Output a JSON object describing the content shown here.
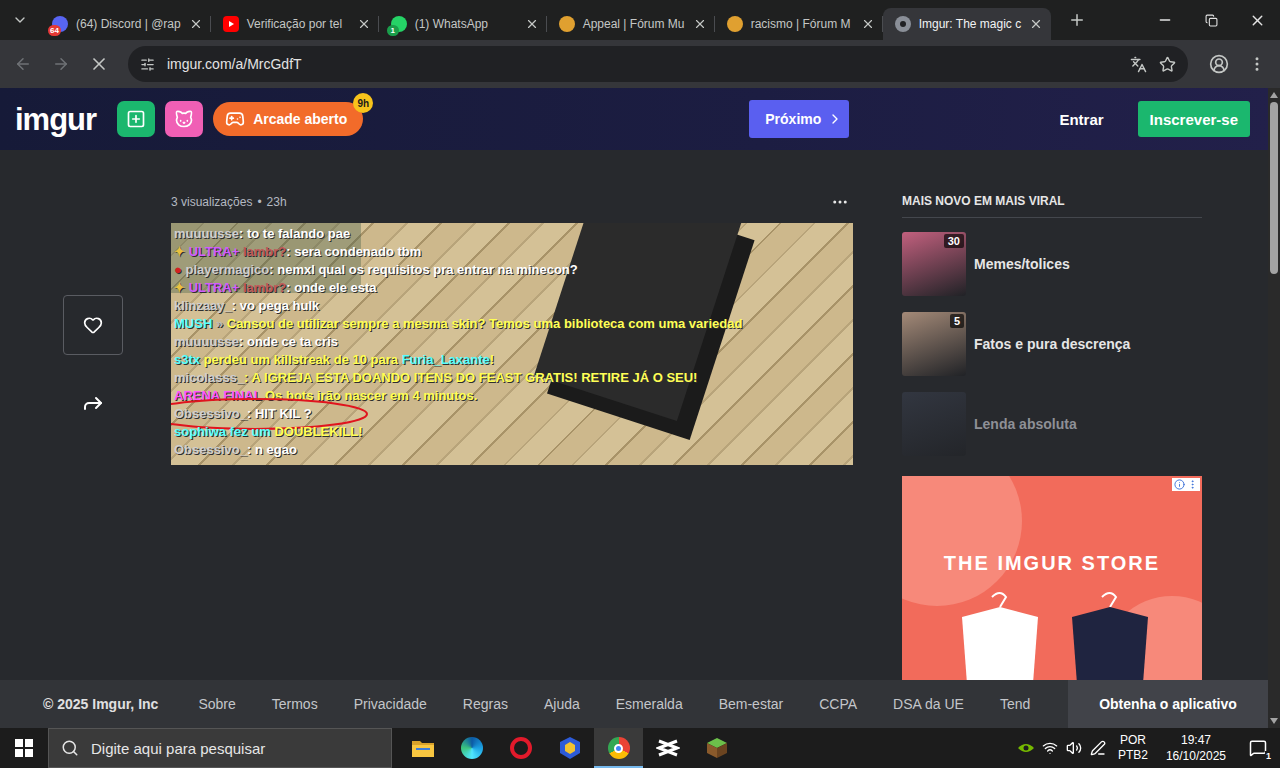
{
  "browser": {
    "tabs": [
      {
        "label": "(64) Discord | @rap",
        "kind": "discord",
        "badge": "64",
        "selected": false
      },
      {
        "label": "Verificação por tel",
        "kind": "youtube",
        "selected": false
      },
      {
        "label": "(1) WhatsApp",
        "kind": "whatsapp",
        "badge": "1",
        "selected": false
      },
      {
        "label": "Appeal | Fórum Mu",
        "kind": "forum",
        "selected": false
      },
      {
        "label": "racismo | Fórum M",
        "kind": "forum",
        "selected": false
      },
      {
        "label": "Imgur: The magic c",
        "kind": "imgur",
        "selected": true
      }
    ],
    "address": "imgur.com/a/MrcGdfT",
    "loading": true
  },
  "imgur_header": {
    "logo": "imgur",
    "arcade": "Arcade aberto",
    "arcade_badge": "9h",
    "next": "Próximo",
    "login": "Entrar",
    "signup": "Inscrever-se"
  },
  "post": {
    "views": "3 visualizações",
    "separator": "•",
    "age": "23h",
    "liked": false,
    "chat": [
      {
        "circled": false,
        "segments": [
          {
            "text": "muuuusse",
            "color": "#cfcfcf"
          },
          {
            "text": ": to te falando pae",
            "color": "#ffffff"
          }
        ]
      },
      {
        "circled": false,
        "segments": [
          {
            "text": "✦ ",
            "color": "#e8c040"
          },
          {
            "text": "ULTRA+",
            "color": "#d05cff"
          },
          {
            "text": " lambr?",
            "color": "#c05a5a"
          },
          {
            "text": ": sera condenado tbm",
            "color": "#ffffff"
          }
        ]
      },
      {
        "circled": false,
        "segments": [
          {
            "text": "● ",
            "color": "#d42020"
          },
          {
            "text": "playermagico",
            "color": "#cfcfcf"
          },
          {
            "text": ": nemxl qual os requisitos pra entrar na minecon?",
            "color": "#ffffff"
          }
        ]
      },
      {
        "circled": false,
        "segments": [
          {
            "text": "✦ ",
            "color": "#e8c040"
          },
          {
            "text": "ULTRA+",
            "color": "#d05cff"
          },
          {
            "text": " lambr?",
            "color": "#c05a5a"
          },
          {
            "text": ": onde ele esta",
            "color": "#ffffff"
          }
        ]
      },
      {
        "circled": false,
        "segments": [
          {
            "text": "klinzaay_",
            "color": "#cfcfcf"
          },
          {
            "text": ": vo pega hulk",
            "color": "#ffffff"
          }
        ]
      },
      {
        "circled": false,
        "segments": [
          {
            "text": "MUSH",
            "color": "#55ffff"
          },
          {
            "text": " » ",
            "color": "#bbbbbb"
          },
          {
            "text": "Cansou de utilizar sempre a mesma skin? Temos uma biblioteca com uma variedad",
            "color": "#ffff55"
          }
        ]
      },
      {
        "circled": false,
        "segments": [
          {
            "text": "muuuusse",
            "color": "#cfcfcf"
          },
          {
            "text": ": onde ce ta cris",
            "color": "#ffffff"
          }
        ]
      },
      {
        "circled": false,
        "segments": [
          {
            "text": "s3tx",
            "color": "#55ffff"
          },
          {
            "text": " perdeu um killstreak de 10 para ",
            "color": "#ffff55"
          },
          {
            "text": "Furia_Laxante",
            "color": "#55ffff"
          },
          {
            "text": "!",
            "color": "#ffff55"
          }
        ]
      },
      {
        "circled": false,
        "segments": [
          {
            "text": "micolasss_",
            "color": "#cfcfcf"
          },
          {
            "text": ": A IGREJA ESTA DOANDO ITENS DO FEAST GRATIS! RETIRE JÁ O SEU!",
            "color": "#ffff55"
          }
        ]
      },
      {
        "circled": false,
        "segments": [
          {
            "text": "ARENA FINAL",
            "color": "#ff55ff"
          },
          {
            "text": " Os bots irão nascer em 4 minutos.",
            "color": "#ffff55"
          }
        ]
      },
      {
        "circled": true,
        "segments": [
          {
            "text": "Obsessivo_",
            "color": "#cfcfcf"
          },
          {
            "text": ": HIT KIL ?",
            "color": "#ffffff"
          }
        ]
      },
      {
        "circled": false,
        "segments": [
          {
            "text": "sophiwa fez um ",
            "color": "#55ffff"
          },
          {
            "text": "DOUBLEKILL!",
            "color": "#ffff55"
          }
        ]
      },
      {
        "circled": false,
        "segments": [
          {
            "text": "Obsessivo_",
            "color": "#cfcfcf"
          },
          {
            "text": ": n egao",
            "color": "#ffffff"
          }
        ]
      }
    ]
  },
  "sidebar": {
    "title": "MAIS NOVO EM MAIS VIRAL",
    "items": [
      {
        "label": "Memes/tolices",
        "count": "30",
        "faded": false,
        "color": "#c2607e"
      },
      {
        "label": "Fatos e pura descrença",
        "count": "5",
        "faded": false,
        "color": "#a48a78"
      },
      {
        "label": "Lenda absoluta",
        "faded": true,
        "color": "#3b4150"
      }
    ],
    "ad": "THE IMGUR STORE"
  },
  "footer": {
    "copyright": "© 2025 Imgur, Inc",
    "links": [
      "Sobre",
      "Termos",
      "Privacidade",
      "Regras",
      "Ajuda",
      "Esmeralda",
      "Bem-estar",
      "CCPA",
      "DSA da UE",
      "Tend"
    ],
    "app": "Obtenha o aplicativo"
  },
  "taskbar": {
    "search": "Digite aqui para pesquisar",
    "apps": [
      {
        "kind": "explorer",
        "selected": false
      },
      {
        "kind": "edge",
        "selected": false
      },
      {
        "kind": "opera",
        "selected": false
      },
      {
        "kind": "shield",
        "selected": false
      },
      {
        "kind": "chrome",
        "selected": true
      },
      {
        "kind": "capcut",
        "selected": false
      },
      {
        "kind": "minecraft",
        "selected": false
      }
    ],
    "language": "POR",
    "layout": "PTB2",
    "time": "19:47",
    "date": "16/10/2025",
    "notifications": "1"
  }
}
